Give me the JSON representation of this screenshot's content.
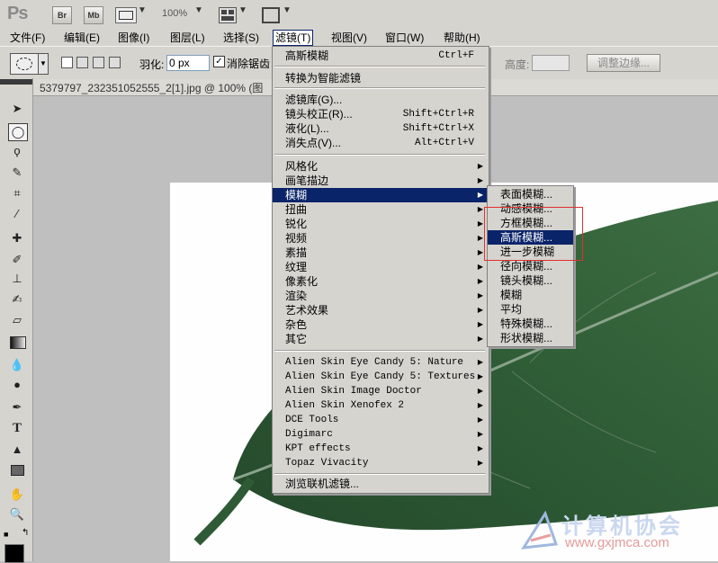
{
  "appbar": {
    "logo": "Ps",
    "br_label": "Br",
    "mb_label": "Mb",
    "zoom": "100%"
  },
  "menubar": [
    {
      "id": "file",
      "label": "文件(F)"
    },
    {
      "id": "edit",
      "label": "编辑(E)"
    },
    {
      "id": "image",
      "label": "图像(I)"
    },
    {
      "id": "layer",
      "label": "图层(L)"
    },
    {
      "id": "select",
      "label": "选择(S)"
    },
    {
      "id": "filter",
      "label": "滤镜(T)"
    },
    {
      "id": "view",
      "label": "视图(V)"
    },
    {
      "id": "window",
      "label": "窗口(W)"
    },
    {
      "id": "help",
      "label": "帮助(H)"
    }
  ],
  "options": {
    "feather_label": "羽化:",
    "feather_value": "0 px",
    "antialias_label": "消除锯齿",
    "height_label": "高度:",
    "refine_edge": "调整边缘..."
  },
  "document": {
    "tab_title": "5379797_232351052555_2[1].jpg @ 100% (图"
  },
  "filter_menu": {
    "items": [
      {
        "label": "高斯模糊",
        "shortcut": "Ctrl+F"
      },
      {
        "label": "转换为智能滤镜"
      },
      {
        "label": "滤镜库(G)..."
      },
      {
        "label": "镜头校正(R)...",
        "shortcut": "Shift+Ctrl+R"
      },
      {
        "label": "液化(L)...",
        "shortcut": "Shift+Ctrl+X"
      },
      {
        "label": "消失点(V)...",
        "shortcut": "Alt+Ctrl+V"
      },
      {
        "label": "风格化",
        "submenu": true
      },
      {
        "label": "画笔描边",
        "submenu": true
      },
      {
        "label": "模糊",
        "submenu": true,
        "highlighted": true
      },
      {
        "label": "扭曲",
        "submenu": true
      },
      {
        "label": "锐化",
        "submenu": true
      },
      {
        "label": "视频",
        "submenu": true
      },
      {
        "label": "素描",
        "submenu": true
      },
      {
        "label": "纹理",
        "submenu": true
      },
      {
        "label": "像素化",
        "submenu": true
      },
      {
        "label": "渲染",
        "submenu": true
      },
      {
        "label": "艺术效果",
        "submenu": true
      },
      {
        "label": "杂色",
        "submenu": true
      },
      {
        "label": "其它",
        "submenu": true
      },
      {
        "label": "Alien Skin Eye Candy 5: Nature",
        "submenu": true
      },
      {
        "label": "Alien Skin Eye Candy 5: Textures",
        "submenu": true
      },
      {
        "label": "Alien Skin Image Doctor",
        "submenu": true
      },
      {
        "label": "Alien Skin Xenofex 2",
        "submenu": true
      },
      {
        "label": "DCE Tools",
        "submenu": true
      },
      {
        "label": "Digimarc",
        "submenu": true
      },
      {
        "label": "KPT effects",
        "submenu": true
      },
      {
        "label": "Topaz Vivacity",
        "submenu": true
      },
      {
        "label": "浏览联机滤镜..."
      }
    ]
  },
  "blur_submenu": {
    "items": [
      {
        "label": "表面模糊..."
      },
      {
        "label": "动感模糊..."
      },
      {
        "label": "方框模糊..."
      },
      {
        "label": "高斯模糊...",
        "highlighted": true
      },
      {
        "label": "进一步模糊"
      },
      {
        "label": "径向模糊..."
      },
      {
        "label": "镜头模糊..."
      },
      {
        "label": "模糊"
      },
      {
        "label": "平均"
      },
      {
        "label": "特殊模糊..."
      },
      {
        "label": "形状模糊..."
      }
    ]
  },
  "watermark": {
    "title": "计算机协会",
    "url": "www.gxjmca.com"
  },
  "colors": {
    "highlight": "#0a246a",
    "menu_bg": "#d6d4cf",
    "annotation_box": "#e03030",
    "leaf": "#2f5a36"
  }
}
